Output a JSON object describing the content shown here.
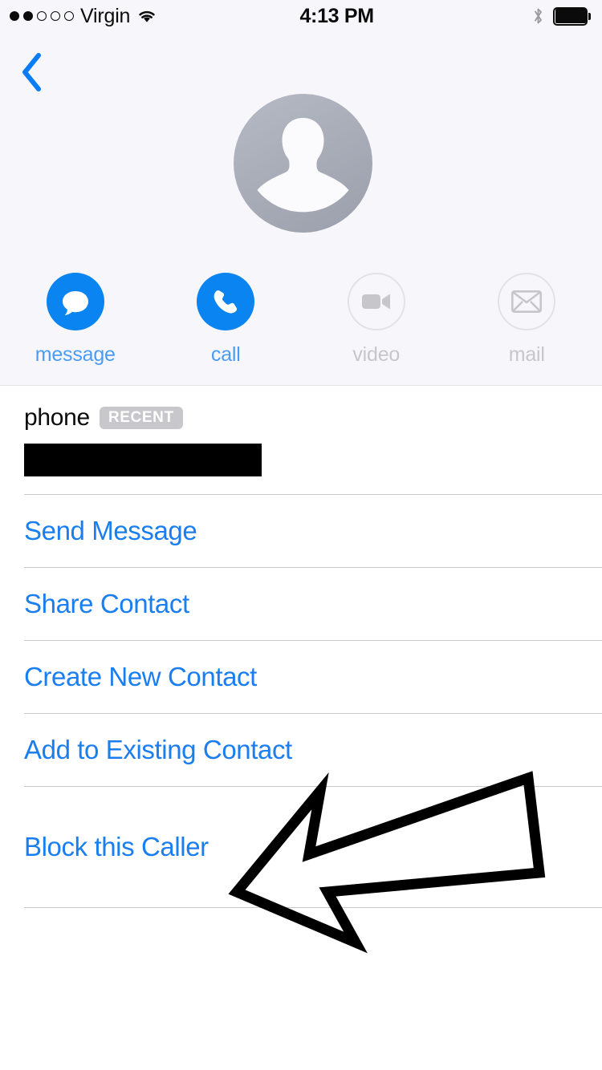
{
  "status_bar": {
    "signal_dots_filled": 2,
    "signal_dots_total": 5,
    "carrier": "Virgin",
    "wifi_icon": "wifi-icon",
    "time": "4:13 PM",
    "bluetooth_icon": "bluetooth-icon",
    "battery_icon": "battery-full-icon"
  },
  "header": {
    "back_icon": "chevron-left-icon",
    "avatar_icon": "person-placeholder-avatar",
    "actions": [
      {
        "label": "message",
        "icon": "message-bubble-icon",
        "enabled": true
      },
      {
        "label": "call",
        "icon": "phone-handset-icon",
        "enabled": true
      },
      {
        "label": "video",
        "icon": "video-camera-icon",
        "enabled": false
      },
      {
        "label": "mail",
        "icon": "envelope-icon",
        "enabled": false
      }
    ]
  },
  "phone_field": {
    "label": "phone",
    "badge": "RECENT",
    "value": "",
    "redacted": true
  },
  "actions_list": [
    {
      "label": "Send Message"
    },
    {
      "label": "Share Contact"
    },
    {
      "label": "Create New Contact"
    },
    {
      "label": "Add to Existing Contact"
    },
    {
      "label": "Block this Caller"
    }
  ],
  "annotation": {
    "type": "hand-drawn-arrow",
    "points_to": "Block this Caller",
    "direction": "left",
    "color": "#000000"
  },
  "colors": {
    "link_blue": "#1A7EF0",
    "accent_blue": "#0A84F0",
    "label_blue": "#4A9BF5",
    "disabled_gray": "#C6C6CB",
    "badge_gray": "#C7C7CC",
    "header_bg": "#F7F7FB",
    "separator": "#C8C7CC"
  }
}
